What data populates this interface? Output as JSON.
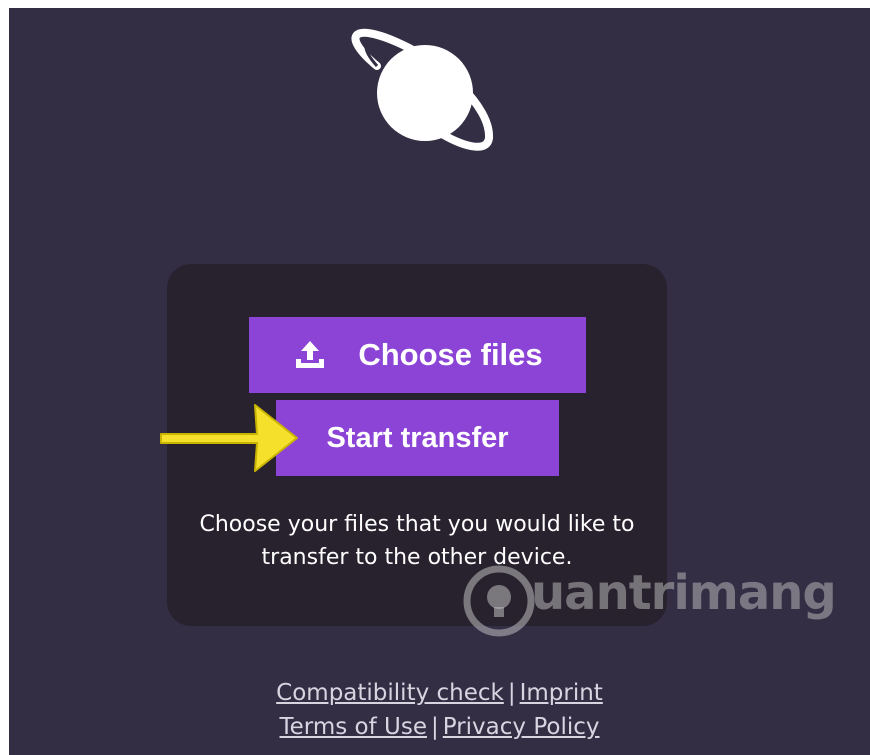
{
  "logo": {
    "icon": "planet-icon"
  },
  "card": {
    "choose_button": {
      "label": "Choose files",
      "icon": "upload-icon"
    },
    "start_button": {
      "label": "Start transfer"
    },
    "hint": "Choose your files that you would like to transfer to the other device."
  },
  "annotation": {
    "icon": "arrow-right-icon",
    "color": "#f5e12c"
  },
  "watermark": {
    "text": "uantrimang"
  },
  "footer": {
    "compatibility": "Compatibility check",
    "imprint": "Imprint",
    "terms": "Terms of Use",
    "privacy": "Privacy Policy",
    "separator": "|"
  },
  "colors": {
    "background": "#342e45",
    "card": "#28222f",
    "accent": "#8b44d6"
  }
}
